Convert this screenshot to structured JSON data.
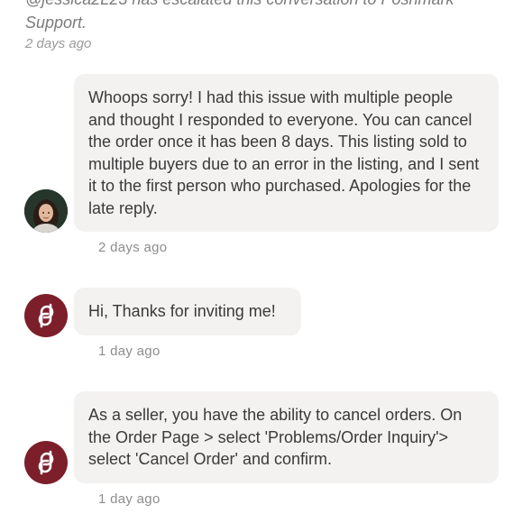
{
  "system_message": {
    "line1": "@jessica2L23 has escalated this conversation to Poshmark",
    "line2": "Support.",
    "time": "2 days ago"
  },
  "messages": [
    {
      "text": "Whoops sorry! I had this issue with multiple people and thought I responded to everyone. You can cancel the order once it has been 8 days. This listing sold to multiple buyers due to an error in the listing, and I sent it to the first person who purchased. Apologies for the late reply.",
      "time": "2 days ago",
      "avatar": "user-photo-avatar"
    },
    {
      "text": "Hi, Thanks for inviting me!",
      "time": "1 day ago",
      "avatar": "poshmark-logo-icon"
    },
    {
      "text": "As a seller, you have the ability to cancel orders. On the Order Page > select 'Problems/Order Inquiry'> select 'Cancel Order' and confirm.",
      "time": "1 day ago",
      "avatar": "poshmark-logo-icon"
    }
  ],
  "colors": {
    "bubble_bg": "#f4f2f1",
    "brand": "#7c1f2b",
    "timestamp": "#8d8d8d"
  }
}
